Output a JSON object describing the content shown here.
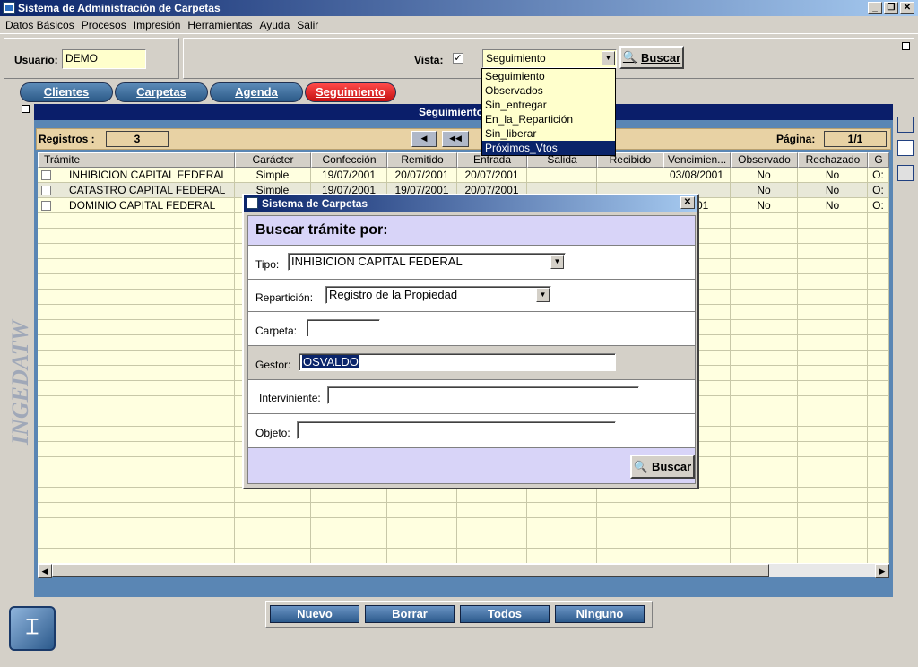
{
  "window": {
    "title": "Sistema de Administración de Carpetas"
  },
  "menu": [
    "Datos Básicos",
    "Procesos",
    "Impresión",
    "Herramientas",
    "Ayuda",
    "Salir"
  ],
  "header": {
    "usuario_label": "Usuario:",
    "usuario_value": "DEMO",
    "vista_label": "Vista:",
    "vista_checked": true,
    "vista_select": "Seguimiento",
    "buscar_label": "Buscar"
  },
  "dropdown_options": [
    "Seguimiento",
    "Observados",
    "Sin_entregar",
    "En_la_Repartición",
    "Sin_liberar",
    "Próximos_Vtos"
  ],
  "dropdown_selected_index": 5,
  "tabs": [
    {
      "label": "Clientes",
      "active": false
    },
    {
      "label": "Carpetas",
      "active": false
    },
    {
      "label": "Agenda",
      "active": false
    },
    {
      "label": "Seguimiento",
      "active": true
    }
  ],
  "section_title": "Seguimiento de T",
  "registros_label": "Registros :",
  "registros_value": "3",
  "pagina_label": "Página:",
  "pagina_value": "1/1",
  "table": {
    "columns": [
      "Trámite",
      "Carácter",
      "Confección",
      "Remitido",
      "Entrada",
      "Salida",
      "Recibido",
      "Vencimien...",
      "Observado",
      "Rechazado",
      "G"
    ],
    "rows": [
      [
        "INHIBICION CAPITAL FEDERAL",
        "Simple",
        "19/07/2001",
        "20/07/2001",
        "20/07/2001",
        "",
        "",
        "03/08/2001",
        "No",
        "No",
        "O:"
      ],
      [
        "CATASTRO CAPITAL FEDERAL",
        "Simple",
        "19/07/2001",
        "19/07/2001",
        "20/07/2001",
        "",
        "",
        "",
        "No",
        "No",
        "O:"
      ],
      [
        "DOMINIO CAPITAL FEDERAL",
        "",
        "",
        "",
        "",
        "",
        "",
        "2001",
        "No",
        "No",
        "O:"
      ]
    ]
  },
  "modal": {
    "title": "Sistema de Carpetas",
    "heading": "Buscar trámite por:",
    "tipo_label": "Tipo:",
    "tipo_value": "INHIBICION CAPITAL FEDERAL",
    "reparticion_label": "Repartición:",
    "reparticion_value": "Registro de la Propiedad",
    "carpeta_label": "Carpeta:",
    "carpeta_value": "",
    "gestor_label": "Gestor:",
    "gestor_value": "OSVALDO",
    "interviniente_label": "Interviniente:",
    "interviniente_value": "",
    "objeto_label": "Objeto:",
    "objeto_value": "",
    "buscar_label": "Buscar"
  },
  "bottom_buttons": [
    "Nuevo",
    "Borrar",
    "Todos",
    "Ninguno"
  ],
  "side_logo": "INGEDATW",
  "colors": {
    "accent": "#0a246a",
    "tab_blue": "#2c5a88",
    "tab_active": "#c41010",
    "field_yellow": "#ffffcc"
  }
}
